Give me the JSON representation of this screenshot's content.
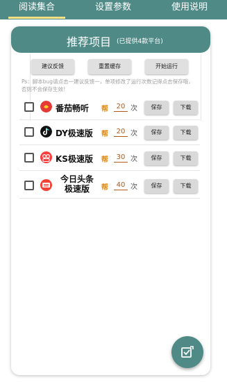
{
  "tabs": [
    {
      "label": "阅读集合",
      "active": true
    },
    {
      "label": "设置参数",
      "active": false
    },
    {
      "label": "使用说明",
      "active": false
    }
  ],
  "card": {
    "title": "推荐项目",
    "subtitle": "(已提供4款平台)",
    "actions": {
      "feedback": "建议反馈",
      "reset_cache": "重置缓存",
      "start_run": "开始运行"
    },
    "notice": "Ps：脚本bug请点击一建议反馈一，单项修改了运行次数记得点击保存哦，否则不会保存生效！"
  },
  "apps": [
    {
      "name": "番茄畅听",
      "count": "20",
      "unit": "次",
      "save": "保存",
      "download": "下载",
      "icon_color": "#e53935"
    },
    {
      "name": "DY极速版",
      "count": "20",
      "unit": "次",
      "save": "保存",
      "download": "下载",
      "icon_color": "#111111"
    },
    {
      "name": "KS极速版",
      "count": "30",
      "unit": "次",
      "save": "保存",
      "download": "下载",
      "icon_color": "#ff3d3d"
    },
    {
      "name": "今日头条\n极速版",
      "count": "40",
      "unit": "次",
      "save": "保存",
      "download": "下载",
      "icon_color": "#f44336"
    }
  ],
  "icons": {
    "qi_glyph": "帮",
    "ks_glyph": "⑧",
    "tt_glyph": "头条"
  },
  "colors": {
    "primary": "#4f8a86",
    "count_text": "#b05a1a",
    "qi": "#e08a1a"
  }
}
